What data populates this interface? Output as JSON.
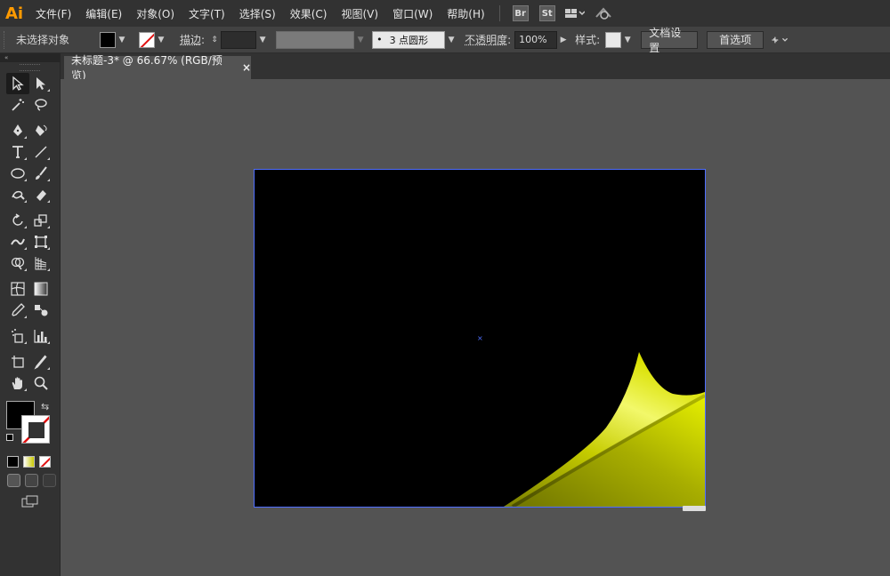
{
  "app": {
    "logo": "Ai"
  },
  "menu": [
    "文件(F)",
    "编辑(E)",
    "对象(O)",
    "文字(T)",
    "选择(S)",
    "效果(C)",
    "视图(V)",
    "窗口(W)",
    "帮助(H)"
  ],
  "menubar_icons": {
    "bridge": "Br",
    "stock": "St",
    "layout": "grid-icon",
    "sync": "sync-icon"
  },
  "control": {
    "selection_status": "未选择对象",
    "stroke_label": "描边",
    "brush_value": "3 点圆形",
    "opacity_label": "不透明度",
    "opacity_value": "100%",
    "style_label": "样式",
    "doc_setup_button": "文档设置",
    "prefs_button": "首选项",
    "fill_color": "#000000",
    "stroke_color": "none"
  },
  "document": {
    "tab_label": "未标题-3* @ 66.67% (RGB/预览)",
    "close_symbol": "×"
  },
  "toolbox": {
    "fill_color": "#000000",
    "stroke_color": "none"
  },
  "artwork": {
    "background": "#000000",
    "curl_color_light": "#e6f000",
    "curl_color_dark": "#7a8000",
    "center_mark": "×"
  }
}
